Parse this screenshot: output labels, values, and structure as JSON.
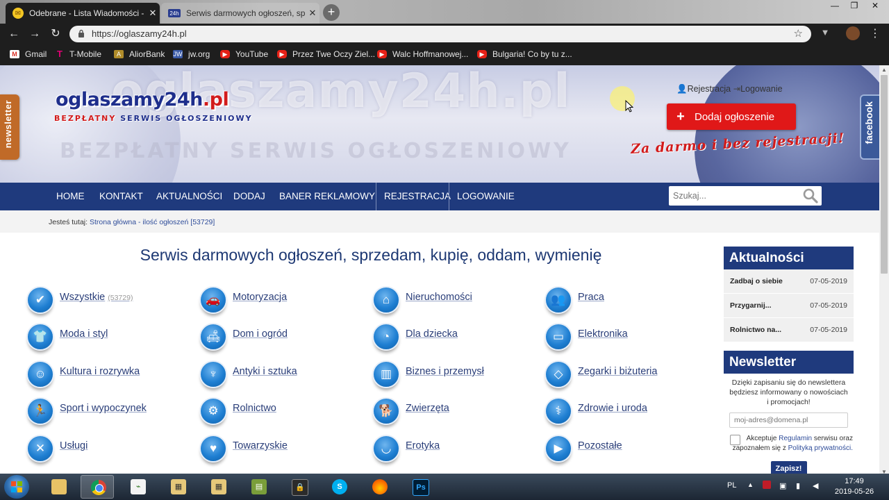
{
  "browser": {
    "tabs": [
      {
        "title": "Odebrane - Lista Wiadomości - P",
        "active": true
      },
      {
        "title": "Serwis darmowych ogłoszeń, spr",
        "active": false
      }
    ],
    "url": "https://oglaszamy24h.pl",
    "bookmarks": [
      {
        "label": "Gmail",
        "icon": "gmail-icon"
      },
      {
        "label": "T-Mobile",
        "icon": "tmobile-icon"
      },
      {
        "label": "AliorBank",
        "icon": "aliorbank-icon"
      },
      {
        "label": "jw.org",
        "icon": "jw-icon"
      },
      {
        "label": "YouTube",
        "icon": "youtube-icon"
      },
      {
        "label": "Przez Twe Oczy Ziel...",
        "icon": "youtube-icon"
      },
      {
        "label": "Walc Hoffmanowej...",
        "icon": "youtube-icon"
      },
      {
        "label": "Bulgaria! Co by tu z...",
        "icon": "youtube-icon"
      }
    ]
  },
  "header": {
    "logo_main": "oglaszamy24h",
    "logo_tld": ".pl",
    "logo_sub_red": "BEZPŁATNY",
    "logo_sub_blue": "SERWIS OGŁOSZENIOWY",
    "bg_logo": "oglaszamy24h.pl",
    "bg_slogan": "BEZPŁATNY SERWIS OGŁOSZENIOWY",
    "register_link": "Rejestracja",
    "login_link": "Logowanie",
    "add_button": "Dodaj ogłoszenie",
    "tagline": "Za darmo i bez rejestracji!",
    "newsletter_tab": "newsletter",
    "facebook_tab": "facebook"
  },
  "nav": {
    "items": [
      "HOME",
      "KONTAKT",
      "AKTUALNOŚCI",
      "DODAJ",
      "BANER REKLAMOWY",
      "REJESTRACJA",
      "LOGOWANIE"
    ],
    "search_placeholder": "Szukaj..."
  },
  "breadcrumb": {
    "prefix": "Jesteś tutaj:",
    "link": "Strona główna - ilość ogłoszeń [53729]"
  },
  "main": {
    "title": "Serwis darmowych ogłoszeń, sprzedam, kupię, oddam, wymienię",
    "categories": [
      {
        "label": "Wszystkie",
        "count": "(53729)",
        "icon": "check-icon"
      },
      {
        "label": "Motoryzacja",
        "icon": "car-icon"
      },
      {
        "label": "Nieruchomości",
        "icon": "house-icon"
      },
      {
        "label": "Praca",
        "icon": "people-icon"
      },
      {
        "label": "Moda i styl",
        "icon": "shirt-icon"
      },
      {
        "label": "Dom i ogród",
        "icon": "sofa-icon"
      },
      {
        "label": "Dla dziecka",
        "icon": "stroller-icon"
      },
      {
        "label": "Elektronika",
        "icon": "monitor-icon"
      },
      {
        "label": "Kultura i rozrywka",
        "icon": "masks-icon"
      },
      {
        "label": "Antyki i sztuka",
        "icon": "lamp-icon"
      },
      {
        "label": "Biznes i przemysł",
        "icon": "building-icon"
      },
      {
        "label": "Zegarki i biżuteria",
        "icon": "diamond-icon"
      },
      {
        "label": "Sport i wypoczynek",
        "icon": "runner-icon"
      },
      {
        "label": "Rolnictwo",
        "icon": "tractor-icon"
      },
      {
        "label": "Zwierzęta",
        "icon": "dog-icon"
      },
      {
        "label": "Zdrowie i uroda",
        "icon": "caduceus-icon"
      },
      {
        "label": "Usługi",
        "icon": "tools-icon"
      },
      {
        "label": "Towarzyskie",
        "icon": "heart-icon"
      },
      {
        "label": "Erotyka",
        "icon": "lips-icon"
      },
      {
        "label": "Pozostałe",
        "icon": "arrow-icon"
      }
    ]
  },
  "sidebar": {
    "news_title": "Aktualności",
    "news": [
      {
        "title": "Zadbaj o siebie",
        "date": "07-05-2019"
      },
      {
        "title": "Przygarnij...",
        "date": "07-05-2019"
      },
      {
        "title": "Rolnictwo na...",
        "date": "07-05-2019"
      }
    ],
    "newsletter_title": "Newsletter",
    "newsletter_text": "Dzięki zapisaniu się do newslettera będziesz informowany o nowościach i promocjach!",
    "email_placeholder": "moj-adres@domena.pl",
    "consent_before": "Akceptuje",
    "consent_link1": "Regulamin",
    "consent_middle": "serwisu oraz zapoznałem się z",
    "consent_link2": "Polityką prywatności.",
    "submit": "Zapisz!"
  },
  "taskbar": {
    "language": "PL",
    "time": "17:49",
    "date": "2019-05-26"
  }
}
